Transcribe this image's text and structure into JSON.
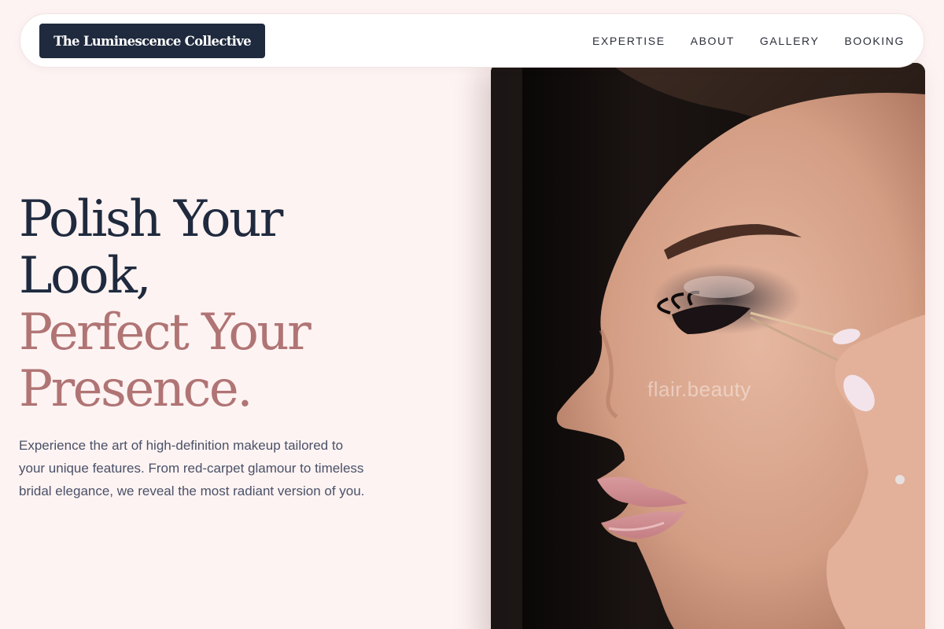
{
  "header": {
    "logo_text": "The Luminescence Collective",
    "nav": [
      {
        "label": "EXPERTISE"
      },
      {
        "label": "ABOUT"
      },
      {
        "label": "GALLERY"
      },
      {
        "label": "BOOKING"
      }
    ]
  },
  "hero": {
    "title_lines": [
      "Polish Your",
      "Look,",
      "Perfect Your",
      "Presence."
    ],
    "description": "Experience the art of high-definition makeup tailored to your unique features. From red-carpet glamour to timeless bridal elegance, we reveal the most radiant version of you.",
    "image_watermark": "flair.beauty"
  },
  "colors": {
    "background": "#fdf3f2",
    "navy": "#1f2a3e",
    "rose": "#b07474",
    "body_text": "#4a5168"
  }
}
